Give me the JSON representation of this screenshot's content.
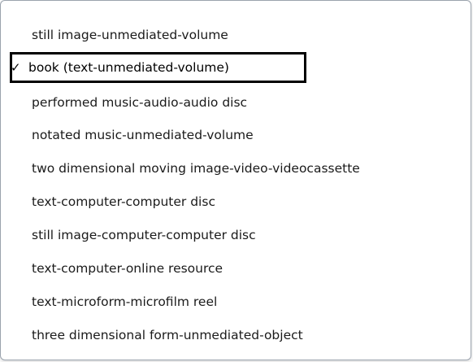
{
  "menu": {
    "items": [
      {
        "label": "still image-unmediated-volume",
        "selected": false
      },
      {
        "label": "book (text-unmediated-volume)",
        "selected": true
      },
      {
        "label": "performed music-audio-audio disc",
        "selected": false
      },
      {
        "label": "notated music-unmediated-volume",
        "selected": false
      },
      {
        "label": "two dimensional moving image-video-videocassette",
        "selected": false
      },
      {
        "label": "text-computer-computer disc",
        "selected": false
      },
      {
        "label": "still image-computer-computer disc",
        "selected": false
      },
      {
        "label": "text-computer-online resource",
        "selected": false
      },
      {
        "label": "text-microform-microfilm reel",
        "selected": false
      },
      {
        "label": "three dimensional form-unmediated-object",
        "selected": false
      }
    ],
    "check_glyph": "✓",
    "check_icon": "checkmark-icon"
  }
}
